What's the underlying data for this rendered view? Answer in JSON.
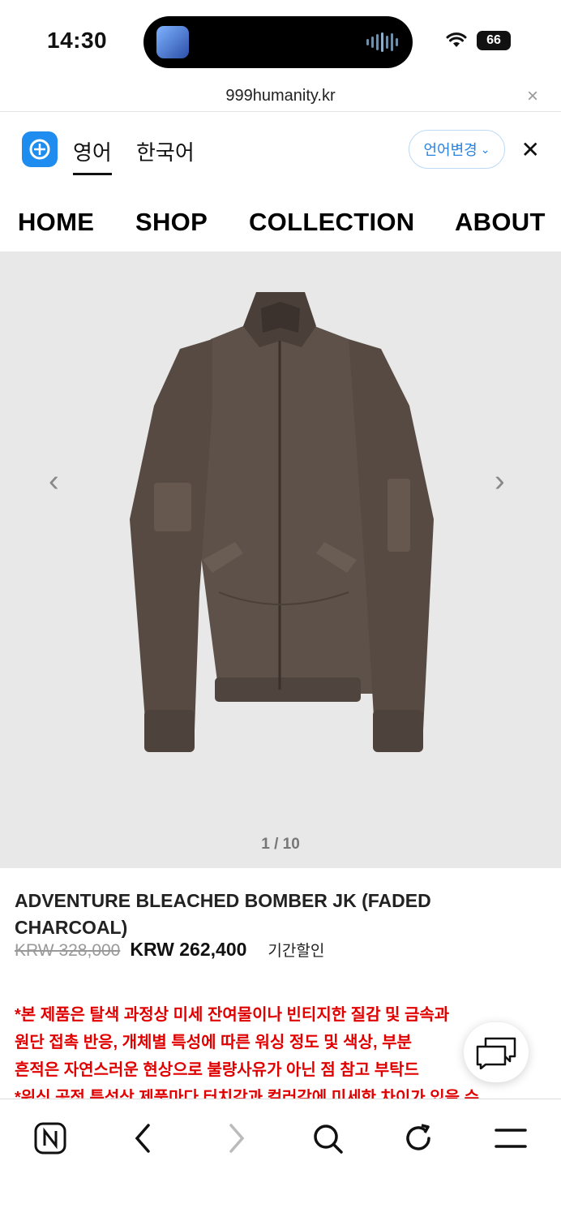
{
  "status_bar": {
    "time": "14:30",
    "battery": "66"
  },
  "browser": {
    "url": "999humanity.kr"
  },
  "translate_bar": {
    "tabs": [
      "영어",
      "한국어"
    ],
    "active_tab": "영어",
    "change_language_label": "언어변경"
  },
  "site_nav": {
    "items": [
      "HOME",
      "SHOP",
      "COLLECTION",
      "ABOUT"
    ]
  },
  "gallery": {
    "counter": "1 / 10",
    "bg_color": "#e8e8e8"
  },
  "product": {
    "title": "ADVENTURE BLEACHED BOMBER JK (FADED CHARCOAL)",
    "original_price": "KRW 328,000",
    "sale_price": "KRW 262,400",
    "sale_tag": "기간할인",
    "notice_lines": [
      "*본 제품은 탈색 과정상 미세 잔여물이나 빈티지한 질감 및 금속과",
      "원단 접촉 반응, 개체별 특성에 따른 워싱 정도 및 색상, 부분",
      "흔적은 자연스러운 현상으로 불량사유가 아닌 점 참고 부탁드",
      "*워싱 공정 특성상 제품마다 터치감과 컬러감에 미세한 차이가 있을 수"
    ]
  },
  "colors": {
    "notice_red": "#e00000",
    "translate_blue": "#1f8cf0",
    "jacket": "#5e5149"
  }
}
